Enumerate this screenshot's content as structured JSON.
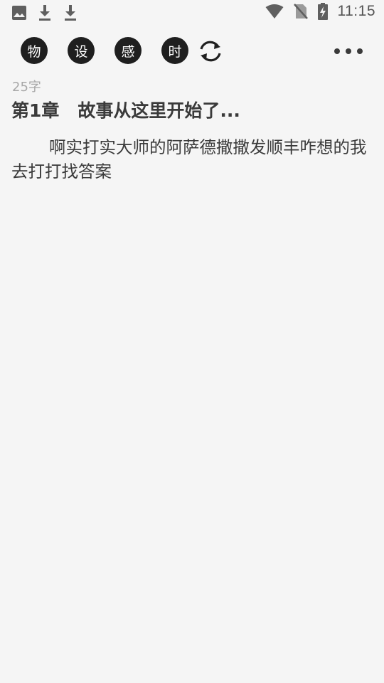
{
  "status_bar": {
    "time": "11:15",
    "left_icons": [
      "image-icon",
      "download-icon",
      "download-icon"
    ],
    "right_icons": [
      "wifi-icon",
      "no-sim-icon",
      "battery-charging-icon"
    ]
  },
  "toolbar": {
    "buttons": [
      {
        "label": "物"
      },
      {
        "label": "设"
      },
      {
        "label": "感"
      },
      {
        "label": "时"
      }
    ],
    "refresh_icon": "refresh-icon",
    "more_icon": "more-horizontal-icon"
  },
  "chapter": {
    "word_count": "25字",
    "number": "第1章",
    "title": "故事从这里开始了...",
    "body": "啊实打实大师的阿萨德撒撒发顺丰咋想的我去打打找答案"
  }
}
